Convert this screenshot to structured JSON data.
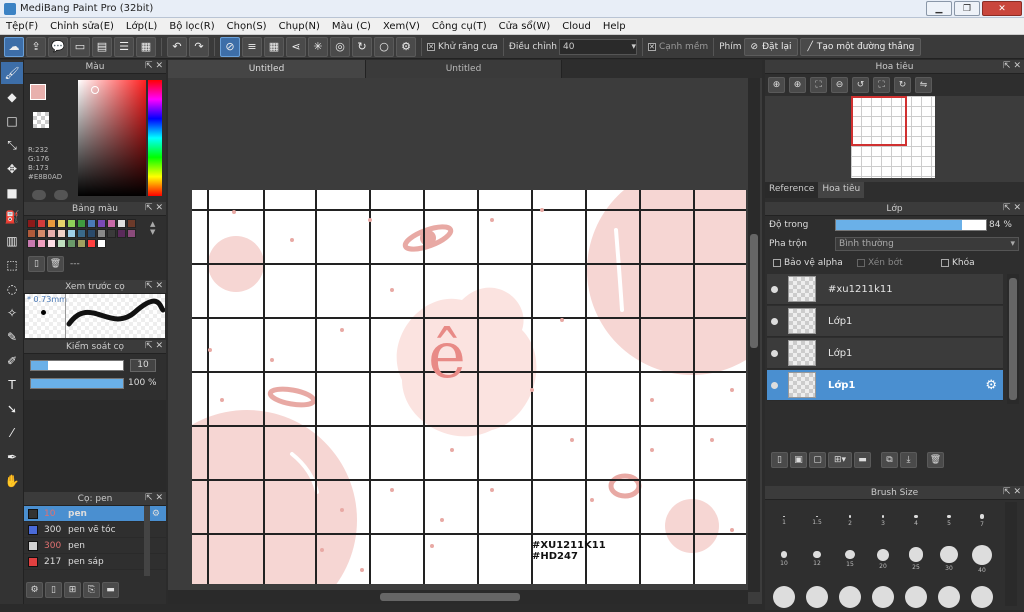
{
  "window": {
    "title": "MediBang Paint Pro (32bit)"
  },
  "menu": [
    "Tệp(F)",
    "Chỉnh sửa(E)",
    "Lớp(L)",
    "Bộ lọc(R)",
    "Chọn(S)",
    "Chụp(N)",
    "Màu (C)",
    "Xem(V)",
    "Công cụ(T)",
    "Cửa sổ(W)",
    "Cloud",
    "Help"
  ],
  "toolbar": {
    "antialias_label": "Khử răng cưa",
    "adjust_label": "Điều chỉnh",
    "adjust_value": "40",
    "soft_edge_label": "Cạnh mềm",
    "key_label": "Phím",
    "reset_label": "Đặt lại",
    "straight_line_label": "Tạo một đường thẳng"
  },
  "color_panel": {
    "title": "Màu",
    "r": "R:232",
    "g": "G:176",
    "b": "B:173",
    "hex": "#E8B0AD",
    "current_color": "#e8b0ad"
  },
  "palette_panel": {
    "title": "Bảng màu",
    "extra": "---",
    "colors": [
      "#8b1a1a",
      "#d23b3b",
      "#e89a3c",
      "#e6d36a",
      "#8fcf5a",
      "#3f9b3f",
      "#4a7ab8",
      "#7a4ab8",
      "#c86aa8",
      "#e0e0e0",
      "#6b3a2a",
      "#b05a3a",
      "#d48a6a",
      "#e8b0ad",
      "#f2d2c8",
      "#a0d0e8",
      "#3a6a8a",
      "#2a4a6a",
      "#8a8a8a",
      "#3a3a3a",
      "#5a2a5a",
      "#8a4a7a",
      "#c87ab0",
      "#f0a0c0",
      "#ffe0e8",
      "#c0e0c0",
      "#6a9a6a",
      "#a0a060",
      "#ff4040",
      "#ffffff"
    ]
  },
  "brush_preview_panel": {
    "title": "Xem trước cọ",
    "size": "* 0.73mm"
  },
  "brush_control_panel": {
    "title": "Kiểm soát cọ",
    "size_value": "10",
    "opacity_value": "100 %"
  },
  "brush_list_panel": {
    "title": "Cọ: pen",
    "items": [
      {
        "size": "10",
        "name": "pen",
        "color": "#333333"
      },
      {
        "size": "300",
        "name": "pen vẽ tóc",
        "color": "#4a6ad8"
      },
      {
        "size": "300",
        "name": "pen",
        "color": "#d0d0d0"
      },
      {
        "size": "217",
        "name": "pen sáp",
        "color": "#e04040"
      }
    ]
  },
  "tabs": [
    "Untitled",
    "Untitled"
  ],
  "canvas": {
    "text_main": "ê",
    "watermark1": "#XU1211K11",
    "watermark2": "#HD247"
  },
  "navigator_panel": {
    "title": "Hoa tiêu",
    "tab_reference": "Reference",
    "tab_navigator": "Hoa tiêu"
  },
  "layer_panel": {
    "title": "Lớp",
    "opacity_label": "Độ trong",
    "opacity_value": "84 %",
    "opacity": 0.84,
    "blend_label": "Pha trộn",
    "blend_value": "Bình thường",
    "protect_alpha": "Bảo vệ alpha",
    "clipping": "Xén bớt",
    "lock": "Khóa",
    "layers": [
      {
        "name": "#xu1211k11"
      },
      {
        "name": "Lớp1"
      },
      {
        "name": "Lớp1"
      },
      {
        "name": "Lớp1"
      }
    ]
  },
  "brush_size_panel": {
    "title": "Brush Size",
    "sizes": [
      "1",
      "1.5",
      "2",
      "3",
      "4",
      "5",
      "7",
      "10",
      "12",
      "15",
      "20",
      "25",
      "30",
      "40"
    ]
  }
}
